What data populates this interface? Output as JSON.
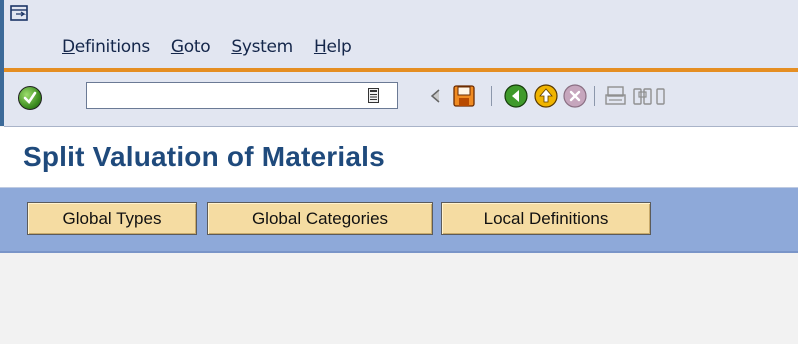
{
  "menu": {
    "items": [
      {
        "mnemonic": "D",
        "rest": "efinitions"
      },
      {
        "mnemonic": "G",
        "rest": "oto"
      },
      {
        "mnemonic": "S",
        "rest": "ystem"
      },
      {
        "mnemonic": "H",
        "rest": "elp"
      }
    ]
  },
  "toolbar": {
    "command_field_value": "",
    "icons": [
      "enter-check-icon",
      "command-history-icon",
      "collapse-left-icon",
      "save-icon",
      "back-icon",
      "exit-icon",
      "cancel-icon",
      "print-icon",
      "find-icon",
      "find-next-icon"
    ]
  },
  "page": {
    "title": "Split Valuation of Materials"
  },
  "app_toolbar": {
    "buttons": [
      {
        "label": "Global Types"
      },
      {
        "label": "Global Categories"
      },
      {
        "label": "Local Definitions"
      }
    ]
  },
  "colors": {
    "title": "#1f4a7c",
    "app_toolbar_bg": "#8ea9d9",
    "button_bg": "#f5dca2",
    "separator_orange": "#e58e22"
  }
}
